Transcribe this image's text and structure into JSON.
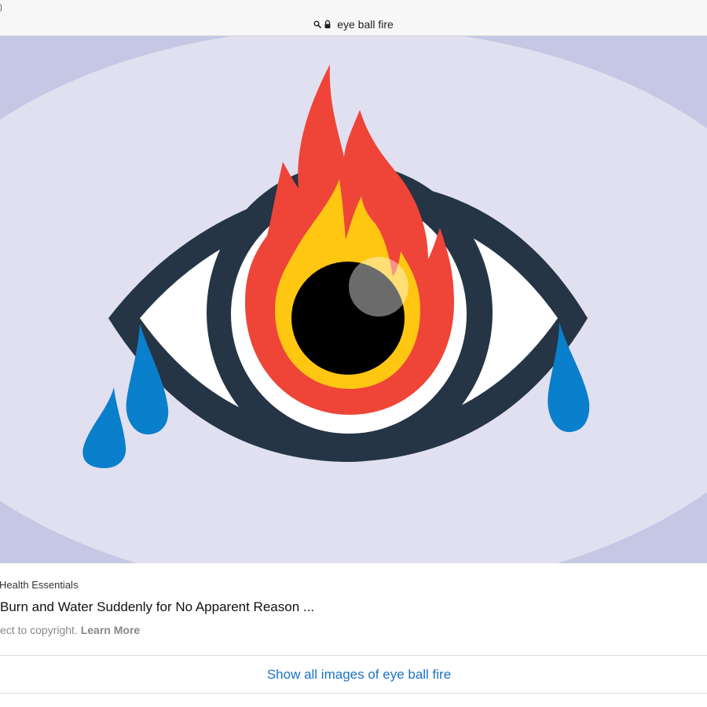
{
  "address_bar": {
    "query": "eye ball fire",
    "icons": [
      "search-icon",
      "lock-icon"
    ]
  },
  "image": {
    "subject": "eye-on-fire-illustration",
    "colors": {
      "background": "#c5c7e4",
      "ellipse": "#e0e0f0",
      "outline": "#253545",
      "flame_outer": "#ef4438",
      "flame_inner": "#ffc612",
      "pupil": "#000000",
      "tear": "#0a7fcb"
    }
  },
  "result": {
    "source": "Health Essentials",
    "title": "Burn and Water Suddenly for No Apparent Reason ...",
    "copyright_text": "ect to copyright.",
    "learn_more": "Learn More"
  },
  "footer": {
    "show_all_label": "Show all images of eye ball fire",
    "link_color": "#1a73c8"
  }
}
